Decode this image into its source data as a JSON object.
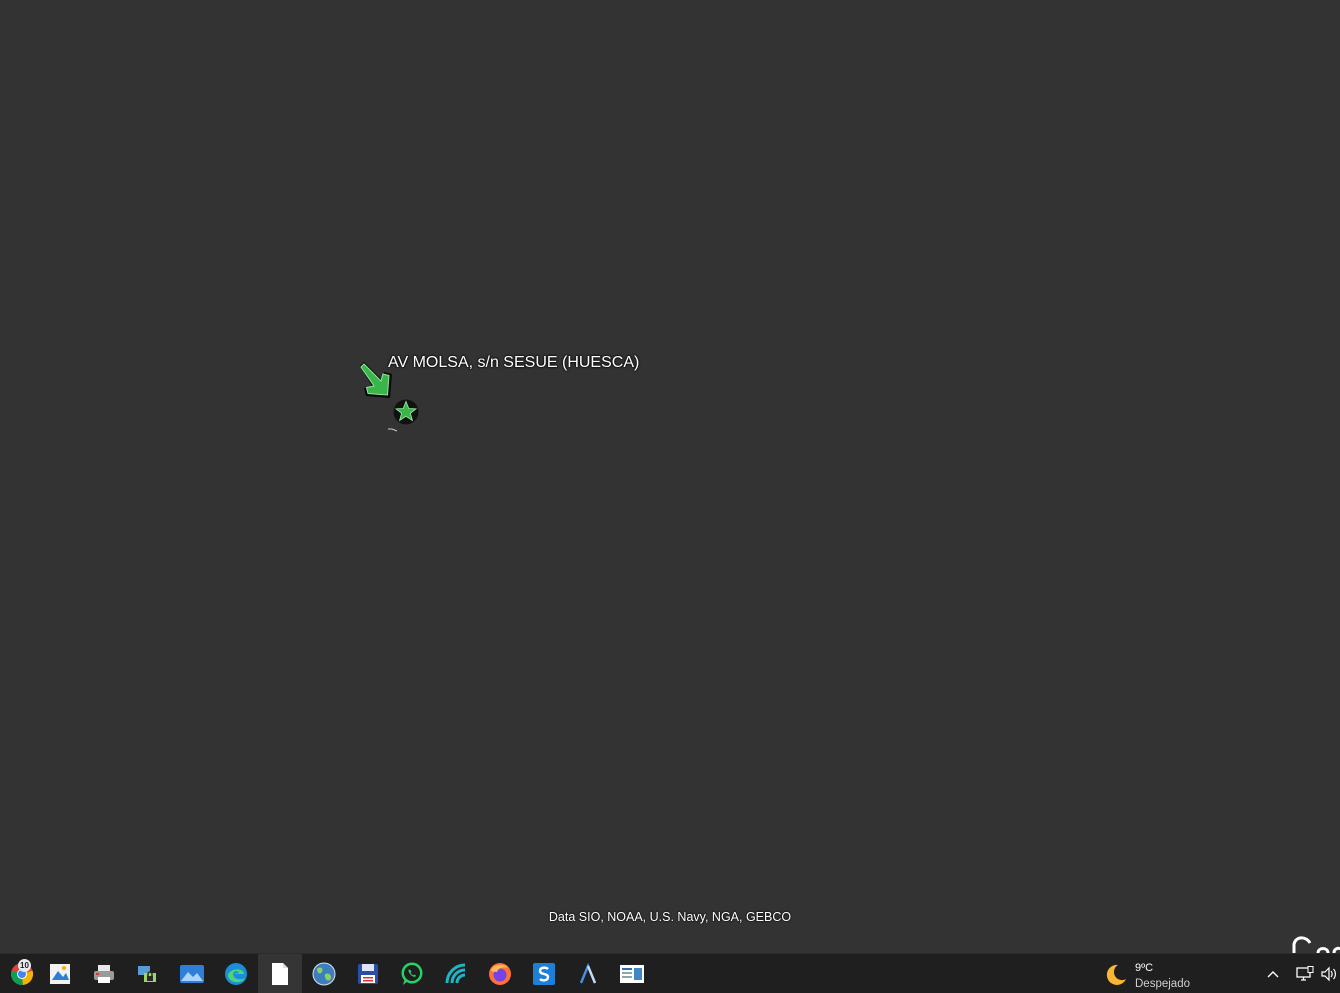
{
  "map": {
    "placemark_label": "AV MOLSA, s/n SESUE (HUESCA)",
    "attribution": "Data SIO, NOAA, U.S. Navy, NGA, GEBCO",
    "logo_fragment": "Goo",
    "marker_color": "#3bb54a",
    "background_color": "#333333"
  },
  "taskbar": {
    "background_color": "#1f1f1f",
    "apps": [
      {
        "name": "chrome",
        "icon": "chrome-icon",
        "badge": "10"
      },
      {
        "name": "image-viewer",
        "icon": "image-viewer-icon"
      },
      {
        "name": "printer",
        "icon": "printer-icon"
      },
      {
        "name": "network-tool",
        "icon": "network-lock-icon"
      },
      {
        "name": "photos",
        "icon": "photos-icon"
      },
      {
        "name": "edge",
        "icon": "edge-icon"
      },
      {
        "name": "document",
        "icon": "document-icon",
        "active": true
      },
      {
        "name": "google-earth",
        "icon": "globe-icon"
      },
      {
        "name": "save-app",
        "icon": "floppy-disk-icon"
      },
      {
        "name": "whatsapp",
        "icon": "whatsapp-icon"
      },
      {
        "name": "streaming-app",
        "icon": "signal-waves-icon"
      },
      {
        "name": "firefox",
        "icon": "firefox-icon"
      },
      {
        "name": "skype",
        "icon": "s-app-icon"
      },
      {
        "name": "autocad",
        "icon": "a-app-icon"
      },
      {
        "name": "reader-app",
        "icon": "reader-icon"
      }
    ],
    "weather": {
      "temperature": "9ºC",
      "condition": "Despejado",
      "icon": "moon-icon"
    },
    "tray": [
      {
        "icon": "chevron-up-icon"
      },
      {
        "icon": "network-icon"
      },
      {
        "icon": "speaker-icon"
      }
    ]
  }
}
